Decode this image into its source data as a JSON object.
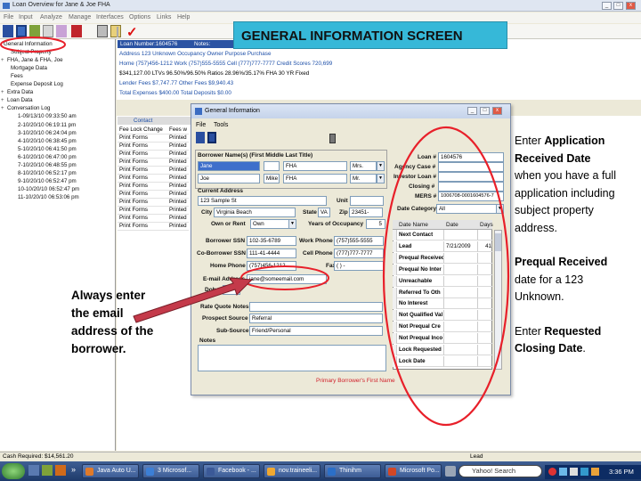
{
  "window": {
    "title": "Loan Overview for Jane & Joe FHA",
    "menu": [
      "File",
      "Input",
      "Analyze",
      "Manage",
      "Interfaces",
      "Options",
      "Links",
      "Help"
    ]
  },
  "banner": {
    "text": "GENERAL INFORMATION SCREEN"
  },
  "tree": {
    "items": [
      {
        "label": "General Information",
        "indent": 0
      },
      {
        "label": "Subject Property",
        "indent": 1
      },
      {
        "label": "FHA, Jane & FHA, Joe",
        "indent": 0
      },
      {
        "label": "Mortgage Data",
        "indent": 1
      },
      {
        "label": "Fees",
        "indent": 1
      },
      {
        "label": "Expense Deposit Log",
        "indent": 1
      },
      {
        "label": "Extra Data",
        "indent": 0
      },
      {
        "label": "Loan Data",
        "indent": 0
      },
      {
        "label": "Conversation Log",
        "indent": 0
      },
      {
        "label": "1-09/13/10 09:33:50 am",
        "indent": 2
      },
      {
        "label": "2-10/20/10 06:19:11 pm",
        "indent": 2
      },
      {
        "label": "3-10/20/10 06:24:04 pm",
        "indent": 2
      },
      {
        "label": "4-10/20/10 06:38:45 pm",
        "indent": 2
      },
      {
        "label": "5-10/20/10 06:41:50 pm",
        "indent": 2
      },
      {
        "label": "6-10/20/10 06:47:00 pm",
        "indent": 2
      },
      {
        "label": "7-10/20/10 06:48:55 pm",
        "indent": 2
      },
      {
        "label": "8-10/20/10 06:52:17 pm",
        "indent": 2
      },
      {
        "label": "9-10/20/10 06:52:47 pm",
        "indent": 2
      },
      {
        "label": "10-10/20/10 06:52:47 pm",
        "indent": 2
      },
      {
        "label": "11-10/20/10 06:53:06 pm",
        "indent": 2
      }
    ]
  },
  "info": {
    "loan_number": "Loan Number:1604576",
    "notes_label": "Notes:",
    "address": "Address 123 Unknown  Occupancy Owner  Purpose Purchase",
    "phones": "Home (757)456-1212  Work (757)555-5555  Cell (777)777-7777     Credit Scores 720,699",
    "amounts": "$341,127.00  LTVs 96.50%/96.50%  Ratios 28.96%/35.17%  FHA 30 YR Fixed",
    "lender_fees": "Lender Fees $7,747.77  Other Fees $9,940.43",
    "totals": "Total Expenses $400.00  Total Deposits $0.00"
  },
  "grid": {
    "headers": [
      "",
      "Contact"
    ],
    "rows": [
      [
        "Fee Lock Change",
        "Fees w"
      ],
      [
        "Print Forms",
        "Printed"
      ],
      [
        "Print Forms",
        "Printed"
      ],
      [
        "Print Forms",
        "Printed"
      ],
      [
        "Print Forms",
        "Printed"
      ],
      [
        "Print Forms",
        "Printed"
      ],
      [
        "Print Forms",
        "Printed"
      ],
      [
        "Print Forms",
        "Printed"
      ],
      [
        "Print Forms",
        "Printed"
      ],
      [
        "Print Forms",
        "Printed"
      ],
      [
        "Print Forms",
        "Printed"
      ],
      [
        "Print Forms",
        "Printed"
      ],
      [
        "Print Forms",
        "Printed"
      ]
    ]
  },
  "dialog": {
    "title": "General Information",
    "menu": [
      "File",
      "Tools"
    ],
    "borrower_names_label": "Borrower Name(s)  (First Middle Last Title)",
    "b1_first": "Jane",
    "b1_last": "FHA",
    "b1_title": "Mrs.",
    "b2_first": "Joe",
    "b2_mike": "Mike",
    "b2_last": "FHA",
    "b2_title": "Mr.",
    "current_address_label": "Current Address",
    "street": "123 Sample St",
    "unit_label": "Unit",
    "city_label": "City",
    "city": "Virginia Beach",
    "state_label": "State",
    "state": "VA",
    "zip_label": "Zip",
    "zip": "23451-",
    "own_rent_label": "Own or Rent",
    "own_rent": "Own",
    "years_label": "Years of Occupancy",
    "years": "5",
    "bssn_label": "Borrower SSN",
    "bssn": "102-35-6789",
    "cobssn_label": "Co-Borrower SSN",
    "cobssn": "111-41-4444",
    "home_phone_label": "Home Phone",
    "home_phone": "(757)456-1212",
    "work_phone_label": "Work Phone",
    "work_phone": "(757)555-5555",
    "cell_phone_label": "Cell Phone",
    "cell_phone": "(777)777-7777",
    "fax_label": "Fax",
    "fax": "(   )   -",
    "email_label": "E-mail Address",
    "email": "jane@someemail.com",
    "dob_label": "Dob",
    "rate_quote_label": "Rate Quote Notes",
    "prospect_label": "Prospect Source",
    "prospect": "Referral",
    "subsource_label": "Sub-Source",
    "subsource": "Friend/Personal",
    "notes_label": "Notes",
    "loan_no_label": "Loan #",
    "loan_no": "1604576",
    "agency_case_label": "Agency Case #",
    "investor_loan_label": "Investor Loan #",
    "closing_label": "Closing #",
    "mers_label": "MERS #",
    "mers": "1006708-0001604576-7",
    "date_category_label": "Date Category",
    "date_category": "All",
    "ms_headers": [
      "Date Name",
      "Date",
      "Days"
    ],
    "milestones": [
      {
        "name": "Next Contact",
        "date": "",
        "days": ""
      },
      {
        "name": "Lead",
        "date": "7/21/2009",
        "days": "41"
      },
      {
        "name": "Prequal Received",
        "date": "",
        "days": ""
      },
      {
        "name": "Prequal No Inter",
        "date": "",
        "days": ""
      },
      {
        "name": "Unreachable",
        "date": "",
        "days": ""
      },
      {
        "name": "Referred To Oth",
        "date": "",
        "days": ""
      },
      {
        "name": "No Interest",
        "date": "",
        "days": ""
      },
      {
        "name": "Not Qualified Val",
        "date": "",
        "days": ""
      },
      {
        "name": "Not Prequal Cre",
        "date": "",
        "days": ""
      },
      {
        "name": "Not Prequal Inco",
        "date": "",
        "days": ""
      },
      {
        "name": "Lock Requested",
        "date": "",
        "days": ""
      },
      {
        "name": "Lock Date",
        "date": "",
        "days": ""
      }
    ],
    "footer": "Primary Borrower's First Name"
  },
  "annotations": {
    "left": [
      "Always enter",
      "the email",
      "address of the",
      "borrower."
    ],
    "right": {
      "p1": [
        {
          "t": "Enter ",
          "b": "Application"
        },
        {
          "t": "",
          "b": "Received  Date"
        },
        {
          "t": "when you have a full",
          "b": ""
        },
        {
          "t": "application including",
          "b": ""
        },
        {
          "t": "subject property",
          "b": ""
        },
        {
          "t": "address.",
          "b": ""
        }
      ],
      "p2": [
        {
          "t": "",
          "b": "Prequal Received"
        },
        {
          "t": "date for a 123",
          "b": ""
        },
        {
          "t": "Unknown.",
          "b": ""
        }
      ],
      "p3": [
        {
          "t": "Enter ",
          "b": "Requested"
        },
        {
          "t": "",
          "b": "Closing Date",
          "tail": "."
        }
      ]
    }
  },
  "status": {
    "cash": "Cash Required: $14,561.20",
    "lead": "Lead"
  },
  "taskbar": {
    "items": [
      "Java Auto U...",
      "3 Microsof...",
      "Facebook - ...",
      "nov.traineeli...",
      "Thinihm",
      "Microsoft Po..."
    ],
    "search_placeholder": "Yahoo! Search",
    "time": "3:36 PM"
  },
  "colors": {
    "banner": "#36b8d8",
    "oval": "#e8202a",
    "arrow": "#c43a4a"
  }
}
